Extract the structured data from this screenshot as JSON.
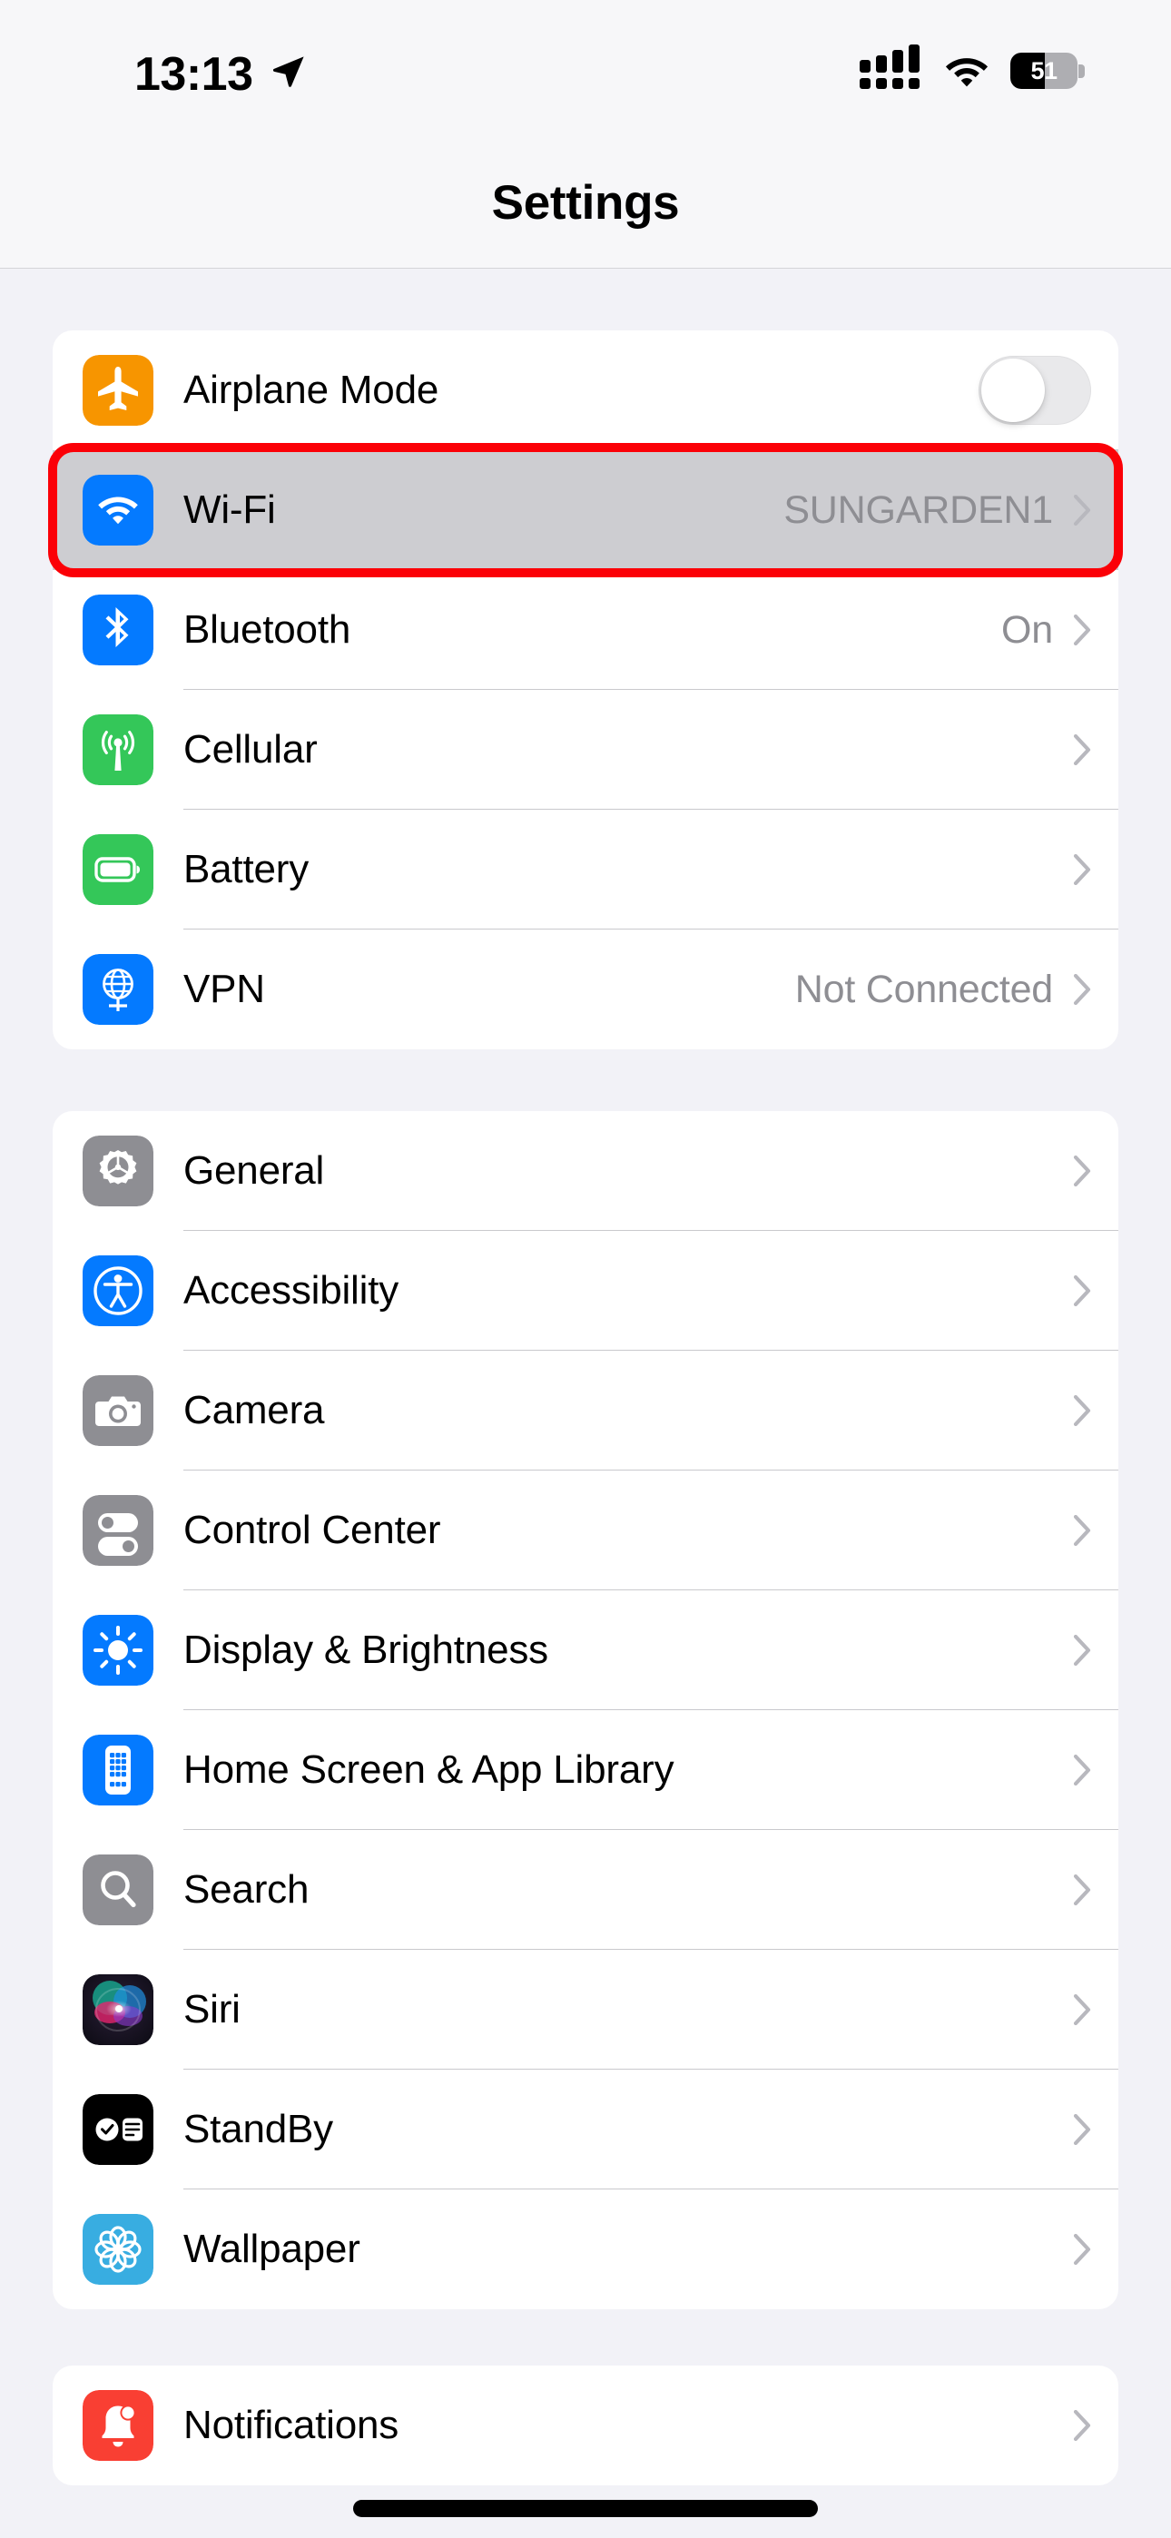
{
  "status_bar": {
    "time": "13:13",
    "location_icon": "location-arrow-icon",
    "cellular_icon": "cellular-signal-icon",
    "wifi_icon": "wifi-icon",
    "battery_percent": "51",
    "battery_level": 51
  },
  "navbar": {
    "title": "Settings"
  },
  "groups": [
    {
      "id": "connectivity",
      "rows": [
        {
          "id": "airplane-mode",
          "label": "Airplane Mode",
          "icon": "airplane-icon",
          "icon_color": "#f79500",
          "control": "toggle",
          "toggle_on": false,
          "value": ""
        },
        {
          "id": "wifi",
          "label": "Wi-Fi",
          "icon": "wifi-icon",
          "icon_color": "#047aff",
          "control": "chevron",
          "value": "SUNGARDEN1",
          "selected": true,
          "annotated": true
        },
        {
          "id": "bluetooth",
          "label": "Bluetooth",
          "icon": "bluetooth-icon",
          "icon_color": "#047aff",
          "control": "chevron",
          "value": "On"
        },
        {
          "id": "cellular",
          "label": "Cellular",
          "icon": "cellular-antenna-icon",
          "icon_color": "#34c759",
          "control": "chevron",
          "value": ""
        },
        {
          "id": "battery",
          "label": "Battery",
          "icon": "battery-icon",
          "icon_color": "#34c759",
          "control": "chevron",
          "value": ""
        },
        {
          "id": "vpn",
          "label": "VPN",
          "icon": "vpn-globe-icon",
          "icon_color": "#047aff",
          "control": "chevron",
          "value": "Not Connected"
        }
      ]
    },
    {
      "id": "system",
      "rows": [
        {
          "id": "general",
          "label": "General",
          "icon": "gear-icon",
          "icon_color": "#8e8e93",
          "control": "chevron",
          "value": ""
        },
        {
          "id": "accessibility",
          "label": "Accessibility",
          "icon": "accessibility-icon",
          "icon_color": "#047aff",
          "control": "chevron",
          "value": ""
        },
        {
          "id": "camera",
          "label": "Camera",
          "icon": "camera-icon",
          "icon_color": "#8e8e93",
          "control": "chevron",
          "value": ""
        },
        {
          "id": "control-center",
          "label": "Control Center",
          "icon": "control-center-icon",
          "icon_color": "#8e8e93",
          "control": "chevron",
          "value": ""
        },
        {
          "id": "display-brightness",
          "label": "Display & Brightness",
          "icon": "brightness-sun-icon",
          "icon_color": "#047aff",
          "control": "chevron",
          "value": ""
        },
        {
          "id": "home-screen",
          "label": "Home Screen & App Library",
          "icon": "home-screen-grid-icon",
          "icon_color": "#047aff",
          "control": "chevron",
          "value": ""
        },
        {
          "id": "search",
          "label": "Search",
          "icon": "search-icon",
          "icon_color": "#8e8e93",
          "control": "chevron",
          "value": ""
        },
        {
          "id": "siri",
          "label": "Siri",
          "icon": "siri-orb-icon",
          "icon_color": "#1a1024",
          "control": "chevron",
          "value": ""
        },
        {
          "id": "standby",
          "label": "StandBy",
          "icon": "standby-icon",
          "icon_color": "#000000",
          "control": "chevron",
          "value": ""
        },
        {
          "id": "wallpaper",
          "label": "Wallpaper",
          "icon": "wallpaper-flower-icon",
          "icon_color": "#38ade1",
          "control": "chevron",
          "value": ""
        }
      ]
    },
    {
      "id": "notifications-group",
      "rows": [
        {
          "id": "notifications",
          "label": "Notifications",
          "icon": "notification-bell-icon",
          "icon_color": "#f93f33",
          "control": "chevron",
          "value": ""
        }
      ]
    }
  ],
  "annotation": {
    "color": "#fb0007",
    "target_row": "wifi"
  }
}
